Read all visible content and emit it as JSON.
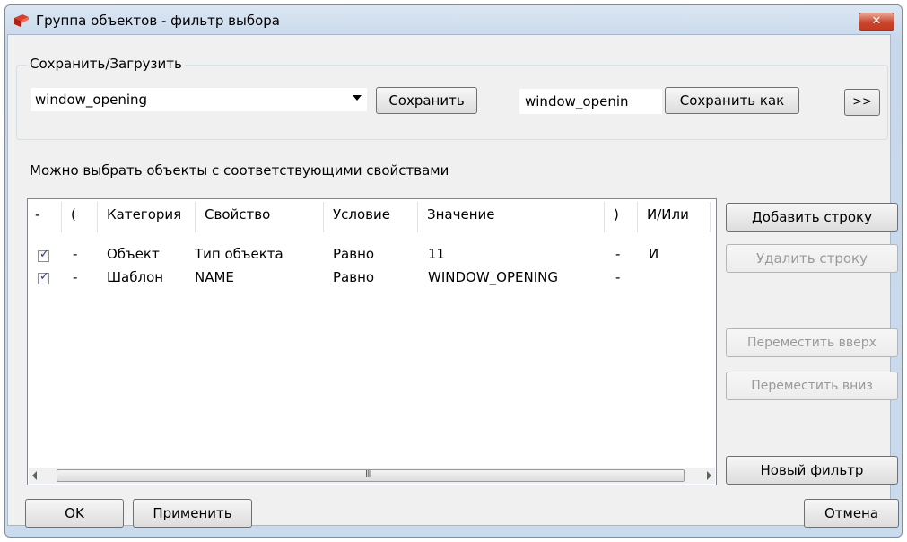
{
  "window": {
    "title": "Группа объектов - фильтр выбора",
    "close_glyph": "✕"
  },
  "save_load": {
    "legend": "Сохранить/Загрузить",
    "combo_value": "window_opening",
    "save_label": "Сохранить",
    "name_value": "window_openin",
    "save_as_label": "Сохранить как",
    "more_label": ">>"
  },
  "caption": "Можно выбрать объекты с соответствующими свойствами",
  "table": {
    "headers": {
      "dash": "-",
      "open_paren": "(",
      "category": "Категория",
      "property": "Свойство",
      "condition": "Условие",
      "value": "Значение",
      "close_paren": ")",
      "and_or": "И/Или"
    },
    "rows": [
      {
        "checked": true,
        "open_paren": "-",
        "category": "Объект",
        "property": "Тип объекта",
        "condition": "Равно",
        "value": "11",
        "close_paren": "-",
        "and_or": "И"
      },
      {
        "checked": true,
        "open_paren": "-",
        "category": "Шаблон",
        "property": "NAME",
        "condition": "Равно",
        "value": "WINDOW_OPENING",
        "close_paren": "-",
        "and_or": ""
      }
    ],
    "scroll_grip": "III"
  },
  "side_buttons": {
    "add_row": "Добавить строку",
    "delete_row": "Удалить строку",
    "move_up": "Переместить вверх",
    "move_down": "Переместить вниз",
    "new_filter": "Новый фильтр"
  },
  "footer": {
    "ok": "OK",
    "apply": "Применить",
    "cancel": "Отмена"
  },
  "colors": {
    "titlebar": "#c9dbed",
    "dialog_bg": "#f0f0f0",
    "close_button": "#c8452b",
    "check_mark": "#2a3c7e"
  }
}
